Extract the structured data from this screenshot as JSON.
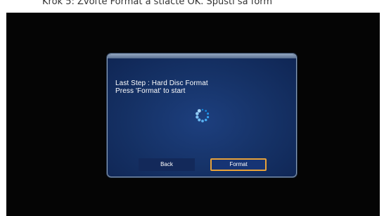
{
  "caption": {
    "text": "Krok 5: Zvoľte Format a stlačte OK. Spustí sa form"
  },
  "dialog": {
    "line1": "Last Step : Hard Disc Format",
    "line2": "Press 'Format' to start",
    "spinner_icon": "loading-spinner-icon",
    "back_label": "Back",
    "format_label": "Format",
    "focus_color": "#e8a23a",
    "panel_color": "#153165"
  }
}
